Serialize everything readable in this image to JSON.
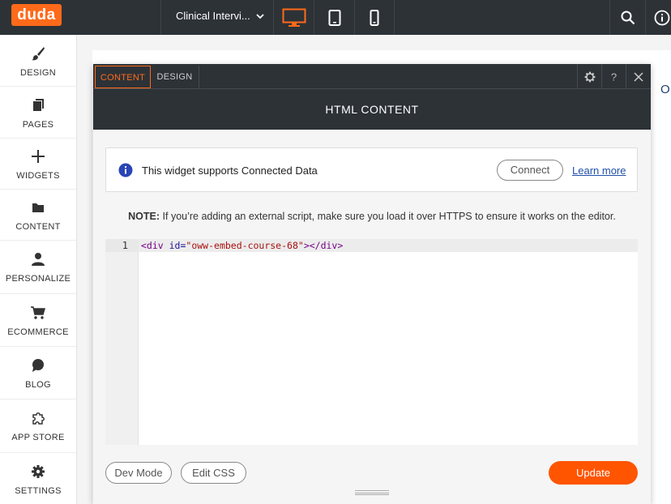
{
  "topbar": {
    "logo_text": "duda",
    "site_name": "Clinical Intervi...",
    "devices": [
      "desktop",
      "tablet",
      "mobile"
    ],
    "active_device": "desktop",
    "accent": "#ff6a1a"
  },
  "sidebar": {
    "items": [
      {
        "label": "DESIGN",
        "icon": "brush-icon"
      },
      {
        "label": "PAGES",
        "icon": "pages-icon"
      },
      {
        "label": "WIDGETS",
        "icon": "plus-icon"
      },
      {
        "label": "CONTENT",
        "icon": "folder-icon"
      },
      {
        "label": "PERSONALIZE",
        "icon": "person-icon"
      },
      {
        "label": "ECOMMERCE",
        "icon": "cart-icon"
      },
      {
        "label": "BLOG",
        "icon": "chat-bubble-icon"
      },
      {
        "label": "APP STORE",
        "icon": "puzzle-icon"
      },
      {
        "label": "SETTINGS",
        "icon": "gear-icon"
      }
    ]
  },
  "canvas": {
    "peek_text": "O"
  },
  "panel": {
    "tabs": [
      {
        "label": "CONTENT",
        "active": true
      },
      {
        "label": "DESIGN",
        "active": false
      }
    ],
    "help_label": "?",
    "title": "HTML CONTENT",
    "info": {
      "message": "This widget supports Connected Data",
      "connect_label": "Connect",
      "learn_more_label": "Learn more"
    },
    "note": {
      "prefix": "NOTE:",
      "text": " If you’re adding an external script, make sure you load it over HTTPS to ensure it works on the editor."
    },
    "editor": {
      "line_number": "1",
      "code": {
        "open_tag": "<div",
        "attr": " id=",
        "value": "\"oww-embed-course-68\"",
        "close": "></div>"
      }
    },
    "buttons": {
      "dev_mode": "Dev Mode",
      "edit_css": "Edit CSS",
      "update": "Update"
    }
  }
}
